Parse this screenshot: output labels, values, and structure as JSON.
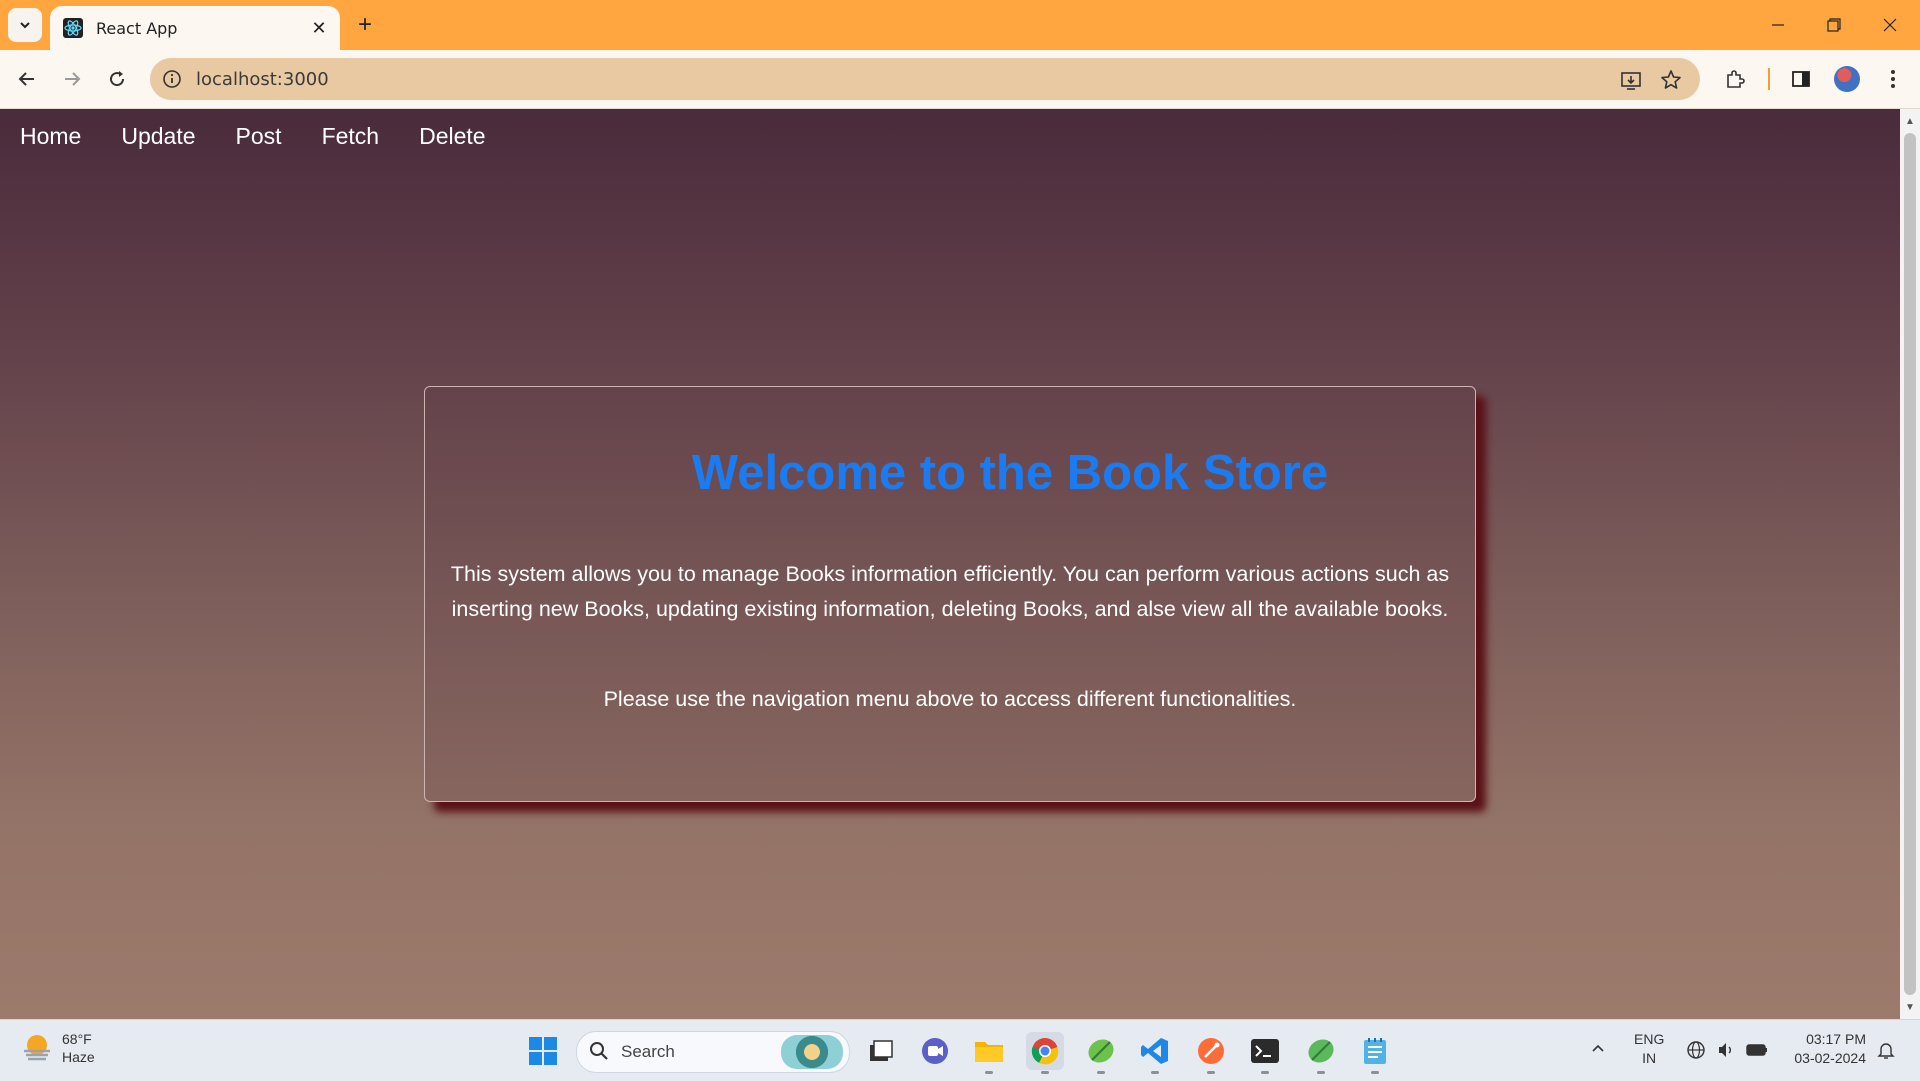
{
  "browser": {
    "tab_title": "React App",
    "url": "localhost:3000"
  },
  "nav": {
    "items": [
      "Home",
      "Update",
      "Post",
      "Fetch",
      "Delete"
    ]
  },
  "card": {
    "heading": "Welcome to the Book Store",
    "description": "This system allows you to manage Books information efficiently. You can perform various actions such as inserting new Books, updating existing information, deleting Books, and alse view all the available books.",
    "hint": "Please use the navigation menu above to access different functionalities."
  },
  "taskbar": {
    "weather_temp": "68°F",
    "weather_desc": "Haze",
    "search_label": "Search",
    "lang_primary": "ENG",
    "lang_secondary": "IN",
    "time": "03:17 PM",
    "date": "03-02-2024"
  },
  "colors": {
    "tab_strip": "#ffa640",
    "heading": "#1a7cf0",
    "card_shadow": "#5a1218"
  },
  "icons": {
    "tab_favicon": "react-logo-icon",
    "tab_close": "close-icon",
    "new_tab": "plus-icon",
    "back": "arrow-left-icon",
    "forward": "arrow-right-icon",
    "reload": "reload-icon",
    "site_info": "info-icon",
    "install": "install-app-icon",
    "bookmark": "star-icon",
    "extensions": "puzzle-icon",
    "side_panel": "side-panel-icon",
    "menu": "kebab-menu-icon"
  }
}
